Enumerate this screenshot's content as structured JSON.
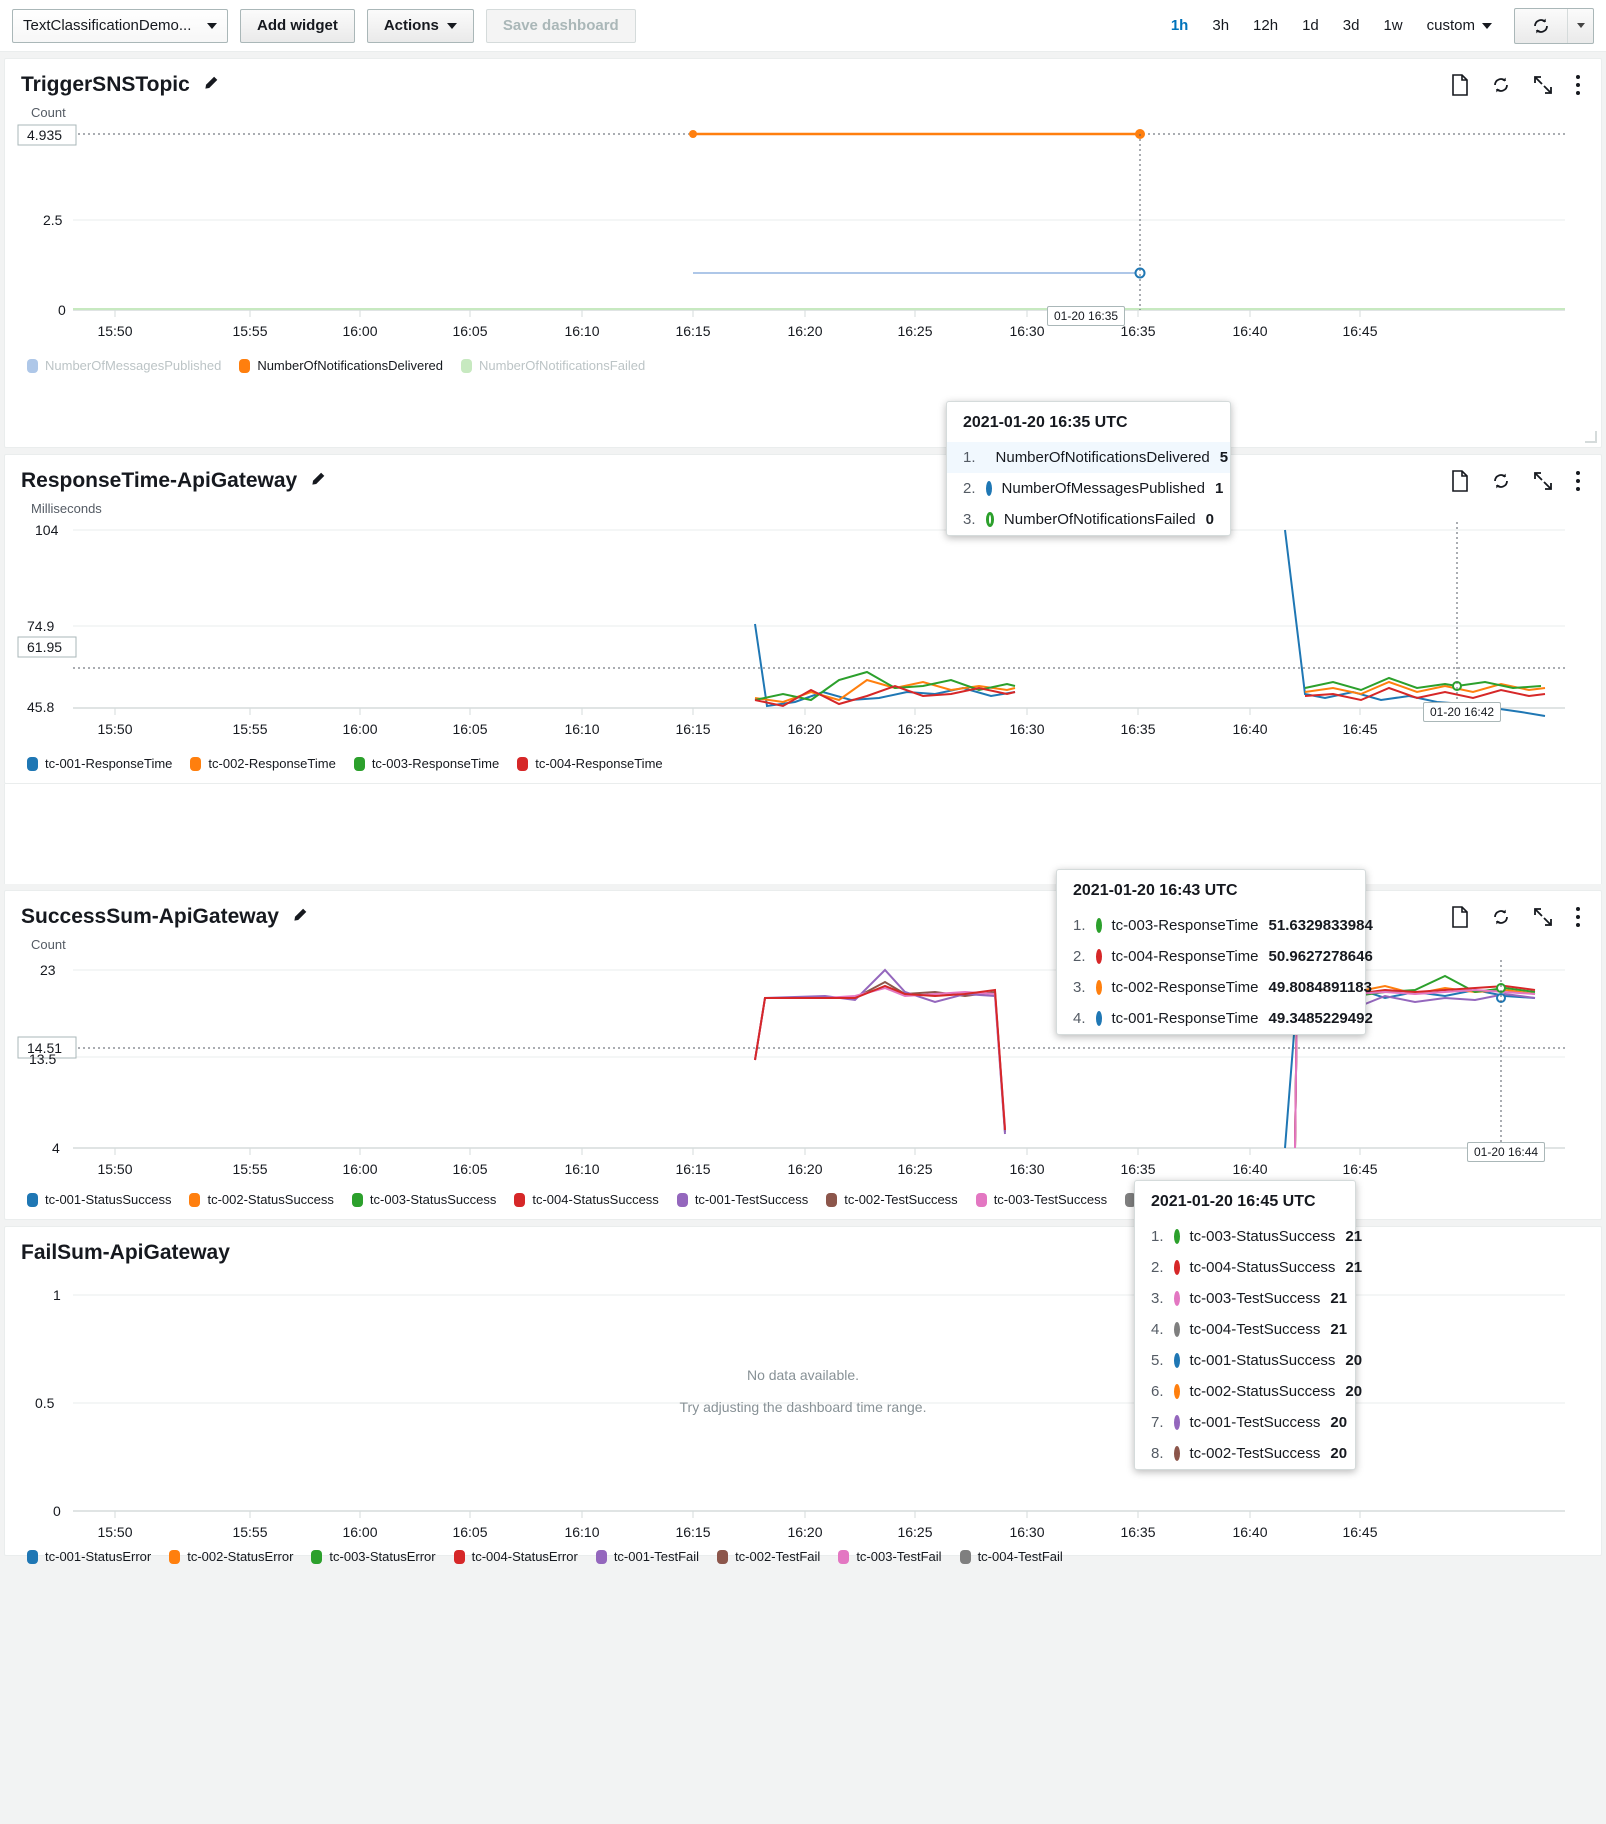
{
  "toolbar": {
    "dashboard_name": "TextClassificationDemo...",
    "add_widget_label": "Add widget",
    "actions_label": "Actions",
    "save_label": "Save dashboard",
    "ranges": [
      "1h",
      "3h",
      "12h",
      "1d",
      "3d",
      "1w"
    ],
    "active_range": "1h",
    "custom_label": "custom"
  },
  "widgets": [
    {
      "title": "TriggerSNSTopic",
      "y_axis_label": "Count",
      "y_ticks": [
        "4.935",
        "2.5",
        "0"
      ],
      "x_ticks": [
        "15:50",
        "15:55",
        "16:00",
        "16:05",
        "16:10",
        "16:15",
        "16:20",
        "16:25",
        "16:30",
        "16:35",
        "16:40",
        "16:45"
      ],
      "legend": [
        {
          "label": "NumberOfMessagesPublished",
          "color": "#aec7e8",
          "dim": true
        },
        {
          "label": "NumberOfNotificationsDelivered",
          "color": "#ff7f0e",
          "dim": false
        },
        {
          "label": "NumberOfNotificationsFailed",
          "color": "#c7e9c0",
          "dim": true
        }
      ],
      "x_flag": "01-20 16:35",
      "tooltip": {
        "title": "2021-01-20 16:35 UTC",
        "rows": [
          {
            "idx": "1.",
            "name": "NumberOfNotificationsDelivered",
            "value": "5",
            "color": "#ff7f0e",
            "filled": true,
            "highlight": true
          },
          {
            "idx": "2.",
            "name": "NumberOfMessagesPublished",
            "value": "1",
            "color": "#1f77b4",
            "filled": false,
            "highlight": false
          },
          {
            "idx": "3.",
            "name": "NumberOfNotificationsFailed",
            "value": "0",
            "color": "#2ca02c",
            "filled": false,
            "highlight": false
          }
        ]
      }
    },
    {
      "title": "ResponseTime-ApiGateway",
      "y_axis_label": "Milliseconds",
      "y_ticks": [
        "104",
        "74.9",
        "61.95",
        "45.8"
      ],
      "x_ticks": [
        "15:50",
        "15:55",
        "16:00",
        "16:05",
        "16:10",
        "16:15",
        "16:20",
        "16:25",
        "16:30",
        "16:35",
        "16:40",
        "16:45"
      ],
      "legend": [
        {
          "label": "tc-001-ResponseTime",
          "color": "#1f77b4",
          "dim": false
        },
        {
          "label": "tc-002-ResponseTime",
          "color": "#ff7f0e",
          "dim": false
        },
        {
          "label": "tc-003-ResponseTime",
          "color": "#2ca02c",
          "dim": false
        },
        {
          "label": "tc-004-ResponseTime",
          "color": "#d62728",
          "dim": false
        }
      ],
      "x_flag": "01-20 16:42",
      "tooltip": {
        "title": "2021-01-20 16:43 UTC",
        "rows": [
          {
            "idx": "1.",
            "name": "tc-003-ResponseTime",
            "value": "51.6329833984",
            "color": "#2ca02c",
            "filled": false,
            "highlight": false
          },
          {
            "idx": "2.",
            "name": "tc-004-ResponseTime",
            "value": "50.9627278646",
            "color": "#d62728",
            "filled": false,
            "highlight": false
          },
          {
            "idx": "3.",
            "name": "tc-002-ResponseTime",
            "value": "49.8084891183",
            "color": "#ff7f0e",
            "filled": false,
            "highlight": false
          },
          {
            "idx": "4.",
            "name": "tc-001-ResponseTime",
            "value": "49.3485229492",
            "color": "#1f77b4",
            "filled": false,
            "highlight": false
          }
        ]
      }
    },
    {
      "title": "SuccessSum-ApiGateway",
      "y_axis_label": "Count",
      "y_ticks": [
        "23",
        "14.51",
        "13.5",
        "4"
      ],
      "x_ticks": [
        "15:50",
        "15:55",
        "16:00",
        "16:05",
        "16:10",
        "16:15",
        "16:20",
        "16:25",
        "16:30",
        "16:35",
        "16:40",
        "16:45"
      ],
      "legend": [
        {
          "label": "tc-001-StatusSuccess",
          "color": "#1f77b4",
          "dim": false
        },
        {
          "label": "tc-002-StatusSuccess",
          "color": "#ff7f0e",
          "dim": false
        },
        {
          "label": "tc-003-StatusSuccess",
          "color": "#2ca02c",
          "dim": false
        },
        {
          "label": "tc-004-StatusSuccess",
          "color": "#d62728",
          "dim": false
        },
        {
          "label": "tc-001-TestSuccess",
          "color": "#9467bd",
          "dim": false
        },
        {
          "label": "tc-002-TestSuccess",
          "color": "#8c564b",
          "dim": false
        },
        {
          "label": "tc-003-TestSuccess",
          "color": "#e377c2",
          "dim": false
        },
        {
          "label": "tc-004-TestSuccess",
          "color": "#7f7f7f",
          "dim": false
        }
      ],
      "x_flag": "01-20 16:44",
      "tooltip": {
        "title": "2021-01-20 16:45 UTC",
        "rows": [
          {
            "idx": "1.",
            "name": "tc-003-StatusSuccess",
            "value": "21",
            "color": "#2ca02c",
            "filled": false,
            "highlight": false
          },
          {
            "idx": "2.",
            "name": "tc-004-StatusSuccess",
            "value": "21",
            "color": "#d62728",
            "filled": false,
            "highlight": false
          },
          {
            "idx": "3.",
            "name": "tc-003-TestSuccess",
            "value": "21",
            "color": "#e377c2",
            "filled": false,
            "highlight": false
          },
          {
            "idx": "4.",
            "name": "tc-004-TestSuccess",
            "value": "21",
            "color": "#7f7f7f",
            "filled": false,
            "highlight": false
          },
          {
            "idx": "5.",
            "name": "tc-001-StatusSuccess",
            "value": "20",
            "color": "#1f77b4",
            "filled": false,
            "highlight": false
          },
          {
            "idx": "6.",
            "name": "tc-002-StatusSuccess",
            "value": "20",
            "color": "#ff7f0e",
            "filled": false,
            "highlight": false
          },
          {
            "idx": "7.",
            "name": "tc-001-TestSuccess",
            "value": "20",
            "color": "#9467bd",
            "filled": false,
            "highlight": false
          },
          {
            "idx": "8.",
            "name": "tc-002-TestSuccess",
            "value": "20",
            "color": "#8c564b",
            "filled": false,
            "highlight": false
          }
        ]
      }
    },
    {
      "title": "FailSum-ApiGateway",
      "y_axis_label": "",
      "y_ticks": [
        "1",
        "0.5",
        "0"
      ],
      "x_ticks": [
        "15:50",
        "15:55",
        "16:00",
        "16:05",
        "16:10",
        "16:15",
        "16:20",
        "16:25",
        "16:30",
        "16:35",
        "16:40",
        "16:45"
      ],
      "no_data_primary": "No data available.",
      "no_data_secondary": "Try adjusting the dashboard time range.",
      "legend": [
        {
          "label": "tc-001-StatusError",
          "color": "#1f77b4",
          "dim": false
        },
        {
          "label": "tc-002-StatusError",
          "color": "#ff7f0e",
          "dim": false
        },
        {
          "label": "tc-003-StatusError",
          "color": "#2ca02c",
          "dim": false
        },
        {
          "label": "tc-004-StatusError",
          "color": "#d62728",
          "dim": false
        },
        {
          "label": "tc-001-TestFail",
          "color": "#9467bd",
          "dim": false
        },
        {
          "label": "tc-002-TestFail",
          "color": "#8c564b",
          "dim": false
        },
        {
          "label": "tc-003-TestFail",
          "color": "#e377c2",
          "dim": false
        },
        {
          "label": "tc-004-TestFail",
          "color": "#7f7f7f",
          "dim": false
        }
      ]
    }
  ],
  "chart_data": [
    {
      "type": "line",
      "title": "TriggerSNSTopic",
      "ylabel": "Count",
      "xlabel": "",
      "ylim": [
        0,
        4.935
      ],
      "yticks": [
        0,
        2.5,
        4.935
      ],
      "x": [
        "15:50",
        "15:55",
        "16:00",
        "16:05",
        "16:10",
        "16:15",
        "16:20",
        "16:25",
        "16:30",
        "16:35",
        "16:40",
        "16:45"
      ],
      "series": [
        {
          "name": "NumberOfMessagesPublished",
          "color": "#aec7e8",
          "values": [
            null,
            null,
            null,
            null,
            null,
            1,
            1,
            1,
            1,
            1,
            null,
            null
          ]
        },
        {
          "name": "NumberOfNotificationsDelivered",
          "color": "#ff7f0e",
          "values": [
            null,
            null,
            null,
            null,
            null,
            5,
            5,
            5,
            5,
            5,
            null,
            null
          ]
        },
        {
          "name": "NumberOfNotificationsFailed",
          "color": "#c7e9c0",
          "values": [
            0,
            0,
            0,
            0,
            0,
            0,
            0,
            0,
            0,
            0,
            0,
            0
          ]
        }
      ],
      "grid": true,
      "legend_position": "bottom"
    },
    {
      "type": "line",
      "title": "ResponseTime-ApiGateway",
      "ylabel": "Milliseconds",
      "xlabel": "",
      "ylim": [
        45.8,
        104
      ],
      "yticks": [
        45.8,
        61.95,
        74.9,
        104
      ],
      "x": [
        "16:15",
        "16:17",
        "16:19",
        "16:21",
        "16:23",
        "16:25",
        "16:37",
        "16:39",
        "16:41",
        "16:43",
        "16:45"
      ],
      "series": [
        {
          "name": "tc-001-ResponseTime",
          "color": "#1f77b4",
          "values": [
            74.9,
            49.0,
            48.5,
            50.0,
            49.5,
            50.5,
            104,
            48.8,
            48.2,
            49.35,
            46.5
          ]
        },
        {
          "name": "tc-002-ResponseTime",
          "color": "#ff7f0e",
          "values": [
            50.5,
            49.5,
            51.0,
            49.8,
            53.0,
            51.5,
            50.5,
            51.5,
            53.0,
            49.81,
            51.0
          ]
        },
        {
          "name": "tc-003-ResponseTime",
          "color": "#2ca02c",
          "values": [
            50.0,
            51.0,
            49.5,
            53.5,
            55.5,
            51.0,
            51.0,
            53.5,
            51.0,
            51.63,
            51.5
          ]
        },
        {
          "name": "tc-004-ResponseTime",
          "color": "#d62728",
          "values": [
            50.0,
            48.5,
            51.5,
            49.0,
            50.0,
            51.5,
            49.5,
            49.5,
            50.5,
            50.96,
            50.0
          ]
        }
      ],
      "grid": true,
      "legend_position": "bottom"
    },
    {
      "type": "line",
      "title": "SuccessSum-ApiGateway",
      "ylabel": "Count",
      "xlabel": "",
      "ylim": [
        4,
        23
      ],
      "yticks": [
        4,
        13.5,
        14.51,
        23
      ],
      "x": [
        "16:15",
        "16:17",
        "16:19",
        "16:21",
        "16:23",
        "16:25",
        "16:37",
        "16:39",
        "16:41",
        "16:43",
        "16:45"
      ],
      "series": [
        {
          "name": "tc-001-StatusSuccess",
          "color": "#1f77b4",
          "values": [
            14,
            20,
            20,
            20,
            20,
            5,
            20,
            20,
            20,
            20,
            20
          ]
        },
        {
          "name": "tc-002-StatusSuccess",
          "color": "#ff7f0e",
          "values": [
            14,
            20,
            20,
            21,
            21,
            5,
            21,
            21,
            21,
            20,
            20
          ]
        },
        {
          "name": "tc-003-StatusSuccess",
          "color": "#2ca02c",
          "values": [
            14,
            20,
            20,
            20,
            20,
            5,
            20,
            22,
            20,
            21,
            21
          ]
        },
        {
          "name": "tc-004-StatusSuccess",
          "color": "#d62728",
          "values": [
            14,
            20,
            21,
            20,
            21,
            5,
            20,
            21,
            21,
            21,
            21
          ]
        },
        {
          "name": "tc-001-TestSuccess",
          "color": "#9467bd",
          "values": [
            14,
            20,
            23,
            19,
            20,
            5,
            20,
            19,
            20,
            20,
            20
          ]
        },
        {
          "name": "tc-002-TestSuccess",
          "color": "#8c564b",
          "values": [
            14,
            20,
            20,
            20,
            21,
            5,
            21,
            20,
            20,
            20,
            20
          ]
        },
        {
          "name": "tc-003-TestSuccess",
          "color": "#e377c2",
          "values": [
            14,
            20,
            20,
            20,
            20,
            5,
            20,
            21,
            21,
            21,
            21
          ]
        },
        {
          "name": "tc-004-TestSuccess",
          "color": "#7f7f7f",
          "values": [
            14,
            20,
            20,
            20,
            20,
            5,
            20,
            20,
            21,
            21,
            21
          ]
        }
      ],
      "grid": true,
      "legend_position": "bottom"
    },
    {
      "type": "line",
      "title": "FailSum-ApiGateway",
      "ylabel": "",
      "xlabel": "",
      "ylim": [
        0,
        1
      ],
      "yticks": [
        0,
        0.5,
        1
      ],
      "x": [
        "15:50",
        "15:55",
        "16:00",
        "16:05",
        "16:10",
        "16:15",
        "16:20",
        "16:25",
        "16:30",
        "16:35",
        "16:40",
        "16:45"
      ],
      "series": [],
      "grid": true,
      "legend_position": "bottom"
    }
  ]
}
